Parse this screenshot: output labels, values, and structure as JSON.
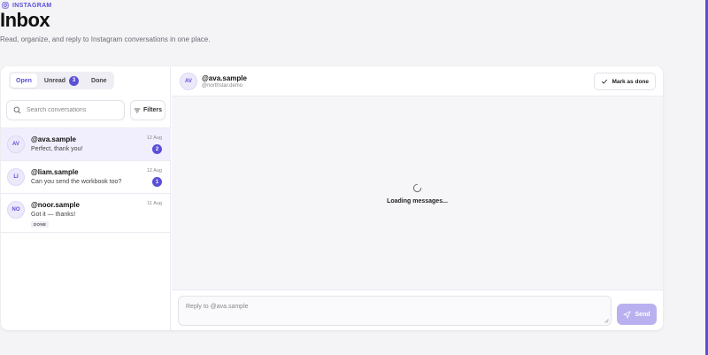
{
  "brand": {
    "name": "INSTAGRAM",
    "icon": "instagram-icon"
  },
  "page": {
    "title": "Inbox",
    "subtitle": "Read, organize, and reply to Instagram conversations in one place."
  },
  "tabs": [
    {
      "label": "Open",
      "active": true
    },
    {
      "label": "Unread",
      "badge": "3"
    },
    {
      "label": "Done"
    }
  ],
  "search": {
    "placeholder": "Search conversations",
    "value": ""
  },
  "filters": {
    "label": "Filters",
    "icon": "filter-icon"
  },
  "conversations": [
    {
      "initials": "AV",
      "name": "@ava.sample",
      "preview": "Perfect, thank you!",
      "date": "12 Aug",
      "unread": "2",
      "selected": true
    },
    {
      "initials": "LI",
      "name": "@liam.sample",
      "preview": "Can you send the workbook too?",
      "date": "12 Aug",
      "unread": "1"
    },
    {
      "initials": "NO",
      "name": "@noor.sample",
      "preview": "Got it — thanks!",
      "date": "11 Aug",
      "tag": "DONE"
    }
  ],
  "chat": {
    "initials": "AV",
    "name": "@ava.sample",
    "handle": "@northstar.demo",
    "mark_done_label": "Mark as done",
    "loading_text": "Loading messages...",
    "reply_placeholder": "Reply to @ava.sample",
    "send_label": "Send"
  },
  "colors": {
    "accent": "#5b4fd6",
    "send_disabled": "#b9b1ef",
    "selected_row": "#f1effd"
  }
}
